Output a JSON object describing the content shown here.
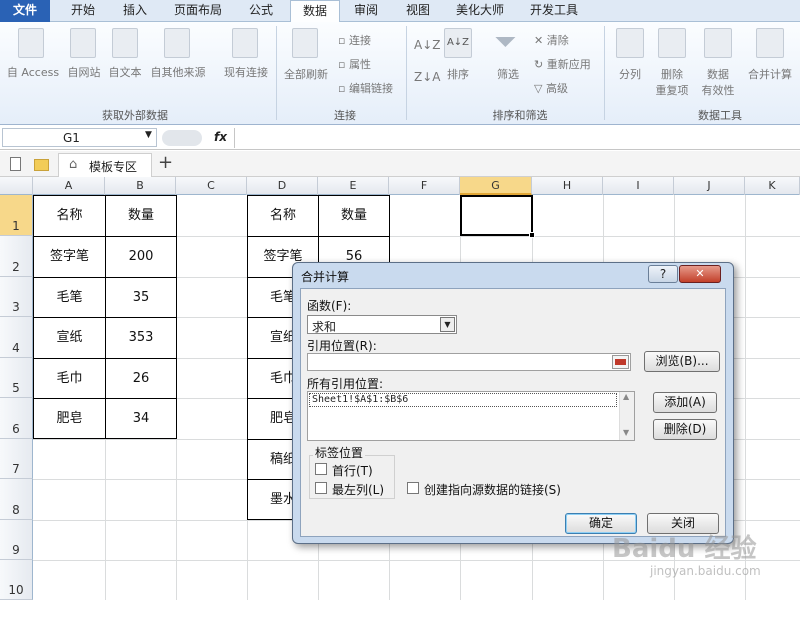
{
  "ribbon_tabs": [
    "文件",
    "开始",
    "插入",
    "页面布局",
    "公式",
    "数据",
    "审阅",
    "视图",
    "美化大师",
    "开发工具"
  ],
  "ribbon": {
    "ext_buttons": [
      "自 Access",
      "自网站",
      "自文本",
      "自其他来源",
      "现有连接"
    ],
    "refresh_all": "全部刷新",
    "conn_items": [
      "连接",
      "属性",
      "编辑链接"
    ],
    "sort_az": "A↓Z",
    "sort": "排序",
    "filter": "筛选",
    "filter_items": [
      "清除",
      "重新应用",
      "高级"
    ],
    "tools": {
      "split": "分列",
      "dedupe_1": "删除",
      "dedupe_2": "重复项",
      "validate_1": "数据",
      "validate_2": "有效性",
      "consolidate": "合并计算"
    },
    "groups": [
      "获取外部数据",
      "连接",
      "排序和筛选",
      "数据工具"
    ]
  },
  "formula_bar": {
    "name_box": "G1",
    "fx": "fx",
    "formula": ""
  },
  "workbook_tab": "模板专区",
  "columns": [
    "A",
    "B",
    "C",
    "D",
    "E",
    "F",
    "G",
    "H",
    "I",
    "J",
    "K"
  ],
  "rows": [
    "1",
    "2",
    "3",
    "4",
    "5",
    "6",
    "7",
    "8",
    "9",
    "10"
  ],
  "table1": {
    "header": [
      "名称",
      "数量"
    ],
    "rows": [
      [
        "签字笔",
        "200"
      ],
      [
        "毛笔",
        "35"
      ],
      [
        "宣纸",
        "353"
      ],
      [
        "毛巾",
        "26"
      ],
      [
        "肥皂",
        "34"
      ]
    ]
  },
  "table2": {
    "header": [
      "名称",
      "数量"
    ],
    "rows": [
      [
        "签字笔",
        "56"
      ],
      [
        "毛笔",
        ""
      ],
      [
        "宣纸",
        ""
      ],
      [
        "毛巾",
        ""
      ],
      [
        "肥皂",
        ""
      ],
      [
        "稿纸",
        ""
      ],
      [
        "墨水",
        ""
      ]
    ]
  },
  "dialog": {
    "title": "合并计算",
    "help": "?",
    "close": "✕",
    "function_label": "函数(F):",
    "function_value": "求和",
    "ref_label": "引用位置(R):",
    "ref_value": "",
    "browse": "浏览(B)...",
    "all_refs_label": "所有引用位置:",
    "all_refs": [
      "Sheet1!$A$1:$B$6"
    ],
    "add": "添加(A)",
    "delete": "删除(D)",
    "label_group": "标签位置",
    "top_row": "首行(T)",
    "left_col": "最左列(L)",
    "link_source": "创建指向源数据的链接(S)",
    "ok": "确定",
    "close_btn": "关闭"
  },
  "watermark": {
    "brand": "Baidu 经验",
    "url": "jingyan.baidu.com"
  }
}
